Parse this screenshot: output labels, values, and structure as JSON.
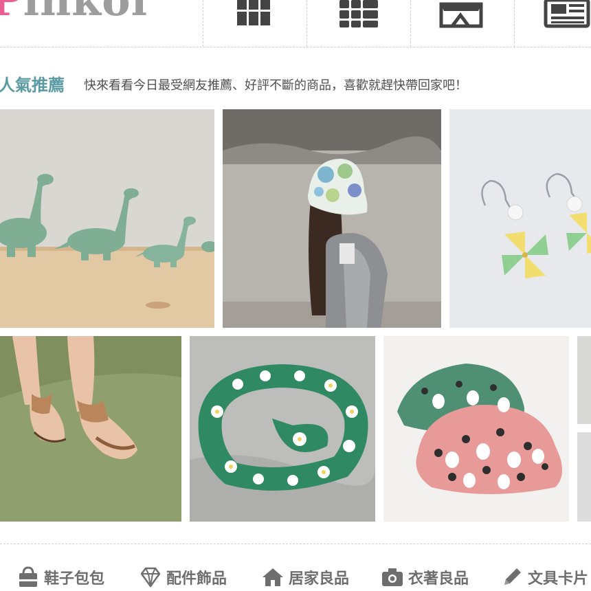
{
  "logo": {
    "part1": "P",
    "part2": "inkoi"
  },
  "top_nav": {
    "icons": [
      "grid-icon",
      "modules-icon",
      "store-icon",
      "newspaper-icon"
    ]
  },
  "section": {
    "title": "人氣推薦",
    "subtitle": "快來看看今日最受網友推薦、好評不斷的商品，喜歡就趕快帶回家吧！"
  },
  "products": [
    "green ceramic dinosaur figurines",
    "watercolor bucket hat",
    "pinwheel pearl earrings",
    "tan leather sandals",
    "green daisy headband",
    "bunny print reversible bucket hat"
  ],
  "categories": [
    {
      "label": "鞋子包包",
      "icon": "bag-icon"
    },
    {
      "label": "配件飾品",
      "icon": "diamond-icon"
    },
    {
      "label": "居家良品",
      "icon": "house-icon"
    },
    {
      "label": "衣著良品",
      "icon": "camera-icon"
    },
    {
      "label": "文具卡片",
      "icon": "pencil-icon"
    }
  ],
  "colors": {
    "accent": "#5a9aa3",
    "logo_pink": "#ea5f91",
    "icon_gray": "#555555"
  }
}
